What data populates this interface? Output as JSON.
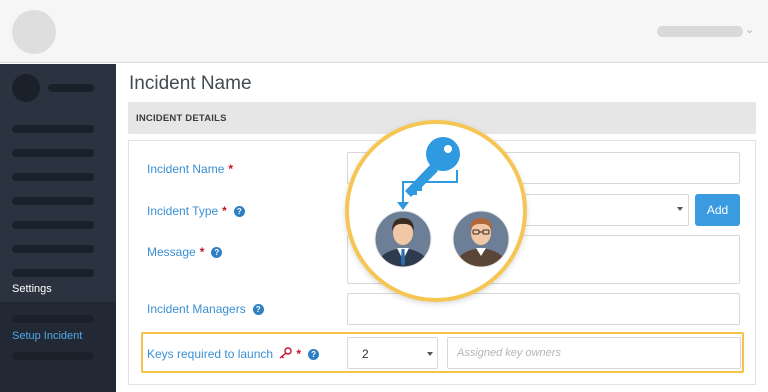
{
  "page": {
    "title": "Incident Name"
  },
  "sidebar": {
    "settings_label": "Settings",
    "active_item_label": "Setup Incident"
  },
  "section": {
    "header": "INCIDENT DETAILS"
  },
  "form": {
    "incident_name_label": "Incident Name",
    "incident_type_label": "Incident Type",
    "message_label": "Message",
    "managers_label": "Incident Managers",
    "keys_label": "Keys required to launch",
    "required_mark": "*",
    "help_glyph": "?",
    "add_button": "Add",
    "keys_value": "2",
    "owners_placeholder": "Assigned key owners"
  },
  "icons": {
    "key_icon": "key-icon",
    "owner_avatars": [
      "avatar-businessman",
      "avatar-glasses-man"
    ],
    "help_icon": "question-circle-icon"
  },
  "colors": {
    "accent_blue": "#3a9be0",
    "label_blue": "#3a8fd3",
    "required_red": "#c8102e",
    "highlight_gold": "#f7c24a",
    "sidebar_bg": "#2b3340"
  }
}
